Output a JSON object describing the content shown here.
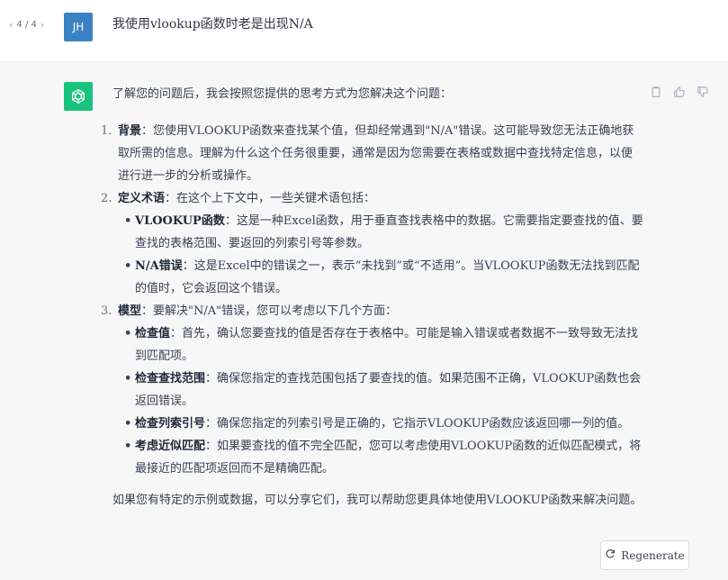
{
  "pager": {
    "prev": "‹",
    "label": "4 / 4",
    "next": "›"
  },
  "user": {
    "avatar_initials": "JH",
    "message": "我使用vlookup函数时老是出现N/A"
  },
  "assistant": {
    "avatar_icon": "openai-logo-icon",
    "intro": "了解您的问题后，我会按照您提供的思考方式为您解决这个问题：",
    "items": [
      {
        "num": "1.",
        "title": "背景",
        "text": "：您使用VLOOKUP函数来查找某个值，但却经常遇到\"N/A\"错误。这可能导致您无法正确地获取所需的信息。理解为什么这个任务很重要，通常是因为您需要在表格或数据中查找特定信息，以便进行进一步的分析或操作。"
      },
      {
        "num": "2.",
        "title": "定义术语",
        "text": "：在这个上下文中，一些关键术语包括：",
        "subs": [
          {
            "title": "VLOOKUP函数",
            "text": "：这是一种Excel函数，用于垂直查找表格中的数据。它需要指定要查找的值、要查找的表格范围、要返回的列索引号等参数。"
          },
          {
            "title": "N/A错误",
            "text": "：这是Excel中的错误之一，表示“未找到”或“不适用”。当VLOOKUP函数无法找到匹配的值时，它会返回这个错误。"
          }
        ]
      },
      {
        "num": "3.",
        "title": "模型",
        "text": "：要解决\"N/A\"错误，您可以考虑以下几个方面：",
        "subs": [
          {
            "title": "检查值",
            "text": "：首先，确认您要查找的值是否存在于表格中。可能是输入错误或者数据不一致导致无法找到匹配项。"
          },
          {
            "title": "检查查找范围",
            "text": "：确保您指定的查找范围包括了要查找的值。如果范围不正确，VLOOKUP函数也会返回错误。"
          },
          {
            "title": "检查列索引号",
            "text": "：确保您指定的列索引号是正确的，它指示VLOOKUP函数应该返回哪一列的值。"
          },
          {
            "title": "考虑近似匹配",
            "text": "：如果要查找的值不完全匹配，您可以考虑使用VLOOKUP函数的近似匹配模式，将最接近的匹配项返回而不是精确匹配。"
          }
        ]
      }
    ],
    "outro": "如果您有特定的示例或数据，可以分享它们，我可以帮助您更具体地使用VLOOKUP函数来解决问题。",
    "actions": [
      "copy-icon",
      "thumbs-up-icon",
      "thumbs-down-icon"
    ]
  },
  "regenerate_label": "Regenerate",
  "colors": {
    "user_avatar": "#3b82c4",
    "bot_avatar": "#19c37d",
    "assistant_bg": "#f7f7f8"
  }
}
